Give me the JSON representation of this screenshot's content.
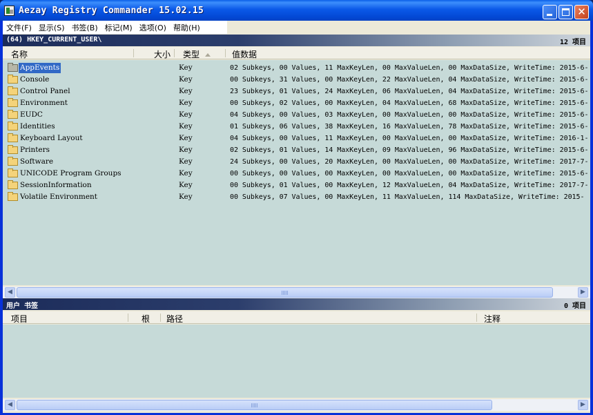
{
  "window": {
    "title": "Aezay Registry Commander 15.02.15"
  },
  "menu": [
    "文件(F)",
    "显示(S)",
    "书签(B)",
    "标记(M)",
    "选项(O)",
    "帮助(H)"
  ],
  "path_bar": {
    "path": "(64) HKEY_CURRENT_USER\\",
    "count": "12 项目"
  },
  "columns": {
    "name": "名称",
    "size": "大小",
    "type": "类型",
    "data": "值数据"
  },
  "rows": [
    {
      "name": "AppEvents",
      "type": "Key",
      "data": "02 Subkeys, 00 Values, 11 MaxKeyLen, 00 MaxValueLen, 00 MaxDataSize, WriteTime: 2015-6-"
    },
    {
      "name": "Console",
      "type": "Key",
      "data": "00 Subkeys, 31 Values, 00 MaxKeyLen, 22 MaxValueLen, 04 MaxDataSize, WriteTime: 2015-6-"
    },
    {
      "name": "Control Panel",
      "type": "Key",
      "data": "23 Subkeys, 01 Values, 24 MaxKeyLen, 06 MaxValueLen, 04 MaxDataSize, WriteTime: 2015-6-"
    },
    {
      "name": "Environment",
      "type": "Key",
      "data": "00 Subkeys, 02 Values, 00 MaxKeyLen, 04 MaxValueLen, 68 MaxDataSize, WriteTime: 2015-6-"
    },
    {
      "name": "EUDC",
      "type": "Key",
      "data": "04 Subkeys, 00 Values, 03 MaxKeyLen, 00 MaxValueLen, 00 MaxDataSize, WriteTime: 2015-6-"
    },
    {
      "name": "Identities",
      "type": "Key",
      "data": "01 Subkeys, 06 Values, 38 MaxKeyLen, 16 MaxValueLen, 78 MaxDataSize, WriteTime: 2015-6-"
    },
    {
      "name": "Keyboard Layout",
      "type": "Key",
      "data": "04 Subkeys, 00 Values, 11 MaxKeyLen, 00 MaxValueLen, 00 MaxDataSize, WriteTime: 2016-1-"
    },
    {
      "name": "Printers",
      "type": "Key",
      "data": "02 Subkeys, 01 Values, 14 MaxKeyLen, 09 MaxValueLen, 96 MaxDataSize, WriteTime: 2015-6-"
    },
    {
      "name": "Software",
      "type": "Key",
      "data": "24 Subkeys, 00 Values, 20 MaxKeyLen, 00 MaxValueLen, 00 MaxDataSize, WriteTime: 2017-7-"
    },
    {
      "name": "UNICODE Program Groups",
      "type": "Key",
      "data": "00 Subkeys, 00 Values, 00 MaxKeyLen, 00 MaxValueLen, 00 MaxDataSize, WriteTime: 2015-6-"
    },
    {
      "name": "SessionInformation",
      "type": "Key",
      "data": "00 Subkeys, 01 Values, 00 MaxKeyLen, 12 MaxValueLen, 04 MaxDataSize, WriteTime: 2017-7-"
    },
    {
      "name": "Volatile Environment",
      "type": "Key",
      "data": "00 Subkeys, 07 Values, 00 MaxKeyLen, 11 MaxValueLen, 114 MaxDataSize, WriteTime: 2015-"
    }
  ],
  "bookmarks_bar": {
    "title": "用户 书签",
    "count": "0 项目"
  },
  "bookmark_columns": {
    "item": "项目",
    "root": "根",
    "path": "路径",
    "note": "注释"
  },
  "colors": {
    "list_bg": "#c6dad8",
    "selection": "#3169c6",
    "titlebar": "#0b59e8"
  }
}
